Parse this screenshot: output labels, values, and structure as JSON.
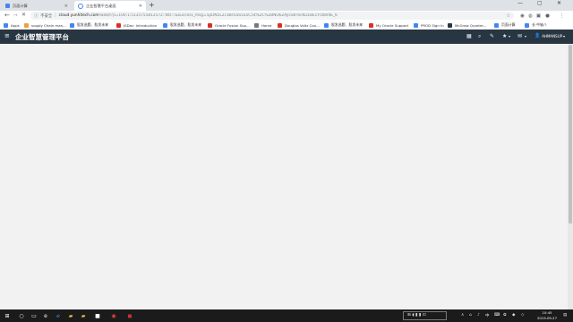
{
  "browser": {
    "tabs": [
      {
        "title": "页面计算",
        "icon": "page-icon"
      },
      {
        "title": "企业智慧平台桌面",
        "icon": "loading-icon"
      }
    ],
    "new_tab_glyph": "+",
    "window_controls": {
      "minimize": "—",
      "maximize": "▢",
      "close": "✕"
    },
    "address": {
      "security_label": "不安全",
      "url_host": "cloud.yunhitech.com",
      "url_rest": "/web/f?p=100:1:5135755812572::NO:::&success_msg=5pDN5L2c3be5aS5S5C54%2C%2BNOkZAyco8?ocKDL8E1YrzBVdE_6"
    },
    "bookmarks": [
      {
        "label": "Apps",
        "color": "#4285f4"
      },
      {
        "label": "supply Chain man...",
        "color": "#e8a33d"
      },
      {
        "label": "股发选题、股发未来",
        "color": "#4285f4"
      },
      {
        "label": "JSDoc: Introduction",
        "color": "#d93025"
      },
      {
        "label": "股发选题、股发未来",
        "color": "#4285f4"
      },
      {
        "label": "Oracle Fusion Sup...",
        "color": "#d93025"
      },
      {
        "label": "Home",
        "color": "#777777"
      },
      {
        "label": "Douglas Voltz Cou...",
        "color": "#d93025"
      },
      {
        "label": "股发选题、股发未来",
        "color": "#4285f4"
      },
      {
        "label": "My Oracle Support",
        "color": "#d93025"
      },
      {
        "label": "PROD Sign In",
        "color": "#4285f4"
      },
      {
        "label": "McGraw Quarter...",
        "color": "#283642"
      },
      {
        "label": "页面计算",
        "color": "#4285f4"
      },
      {
        "label": "长·中轴八",
        "color": "#4285f4"
      }
    ]
  },
  "app": {
    "title": "企业智慧管理平台",
    "user_name": "AHMANSUP",
    "user_caret": "▾"
  },
  "taskbar": {
    "clock_time": "10:45",
    "clock_date": "2019-09-27",
    "ime_label": "中",
    "tray_text": "⊞ ◖ ▮ ▮ ⊡"
  }
}
